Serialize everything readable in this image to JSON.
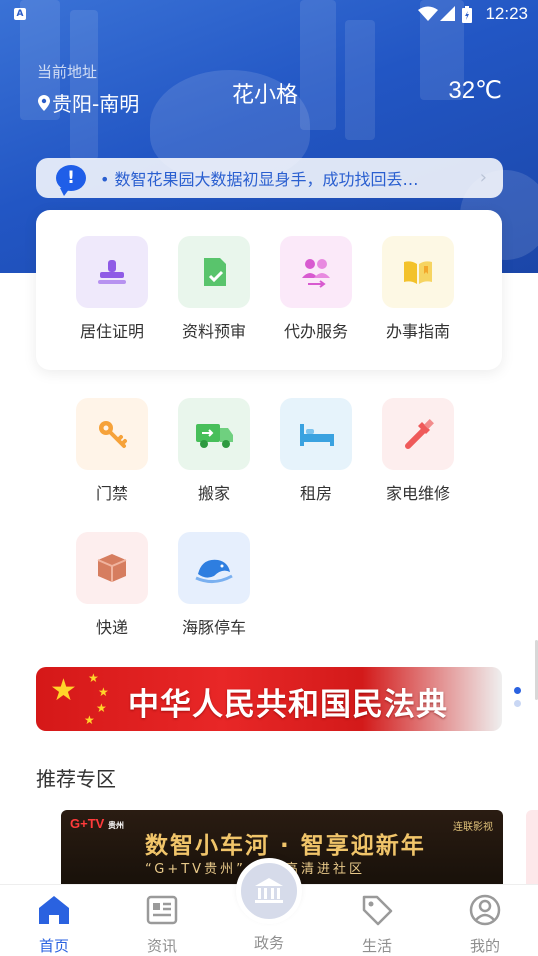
{
  "status_bar": {
    "time": "12:23",
    "app_icon_letter": "A"
  },
  "header": {
    "location_label": "当前地址",
    "location": "贵阳-南明",
    "username": "花小格",
    "temperature": "32℃"
  },
  "notice": {
    "text": "• 数智花果园大数据初显身手，成功找回丢…",
    "bubble_glyph": "!"
  },
  "services_primary": [
    {
      "label": "居住证明",
      "icon": "stamp-icon",
      "bg": "#efe9fb",
      "color": "#8f5be6"
    },
    {
      "label": "资料预审",
      "icon": "document-check-icon",
      "bg": "#e9f6ec",
      "color": "#59c46c"
    },
    {
      "label": "代办服务",
      "icon": "people-transfer-icon",
      "bg": "#fbe9f9",
      "color": "#d85ad0"
    },
    {
      "label": "办事指南",
      "icon": "open-book-icon",
      "bg": "#fdf8e4",
      "color": "#f3c22b"
    }
  ],
  "services_life": [
    {
      "label": "门禁",
      "icon": "key-icon",
      "bg": "#fff4e8",
      "color": "#f6a23a"
    },
    {
      "label": "搬家",
      "icon": "truck-icon",
      "bg": "#e9f6ec",
      "color": "#47bf5a"
    },
    {
      "label": "租房",
      "icon": "bed-icon",
      "bg": "#e6f3fb",
      "color": "#3aa2e0"
    },
    {
      "label": "家电维修",
      "icon": "wrench-icon",
      "bg": "#fdeeee",
      "color": "#ef5a5a"
    },
    {
      "label": "快递",
      "icon": "package-icon",
      "bg": "#fdeeee",
      "color": "#d67d5f"
    },
    {
      "label": "海豚停车",
      "icon": "dolphin-icon",
      "bg": "#e6effd",
      "color": "#2e7ee0"
    }
  ],
  "banner": {
    "title": "中华人民共和国民法典"
  },
  "recommend": {
    "title": "推荐专区",
    "promo_logo": "G+TV",
    "promo_logo_sub": "贵州",
    "promo_brand": "连联影视",
    "promo_main": "数智小车河 · 智享迎新年",
    "promo_sub": "“G+TV贵州” 天翼高清进社区"
  },
  "tabs": [
    {
      "label": "首页",
      "icon": "home-icon",
      "active": true
    },
    {
      "label": "资讯",
      "icon": "news-icon",
      "active": false
    },
    {
      "label": "政务",
      "icon": "government-icon",
      "active": false
    },
    {
      "label": "生活",
      "icon": "tag-icon",
      "active": false
    },
    {
      "label": "我的",
      "icon": "user-icon",
      "active": false
    }
  ],
  "colors": {
    "primary": "#2a62e0",
    "hero": "#2256c4"
  }
}
